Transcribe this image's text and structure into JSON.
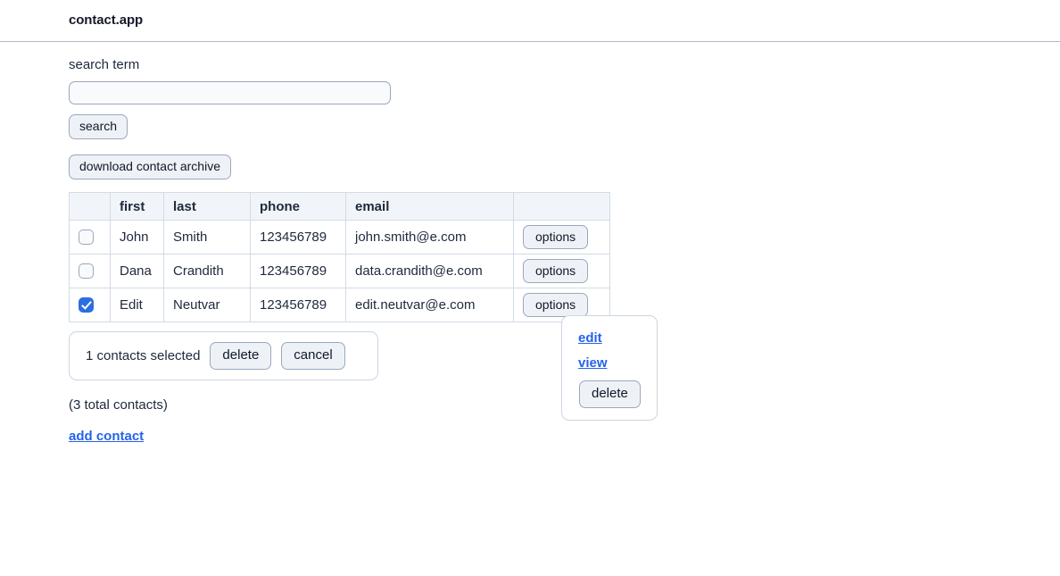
{
  "app": {
    "title": "contact.app"
  },
  "search": {
    "label": "search term",
    "value": "",
    "placeholder": "",
    "button_label": "search"
  },
  "actions": {
    "download_label": "download contact archive"
  },
  "table": {
    "columns": [
      "",
      "first",
      "last",
      "phone",
      "email",
      ""
    ],
    "rows": [
      {
        "selected": false,
        "first": "John",
        "last": "Smith",
        "phone": "123456789",
        "email": "john.smith@e.com",
        "options_label": "options"
      },
      {
        "selected": false,
        "first": "Dana",
        "last": "Crandith",
        "phone": "123456789",
        "email": "data.crandith@e.com",
        "options_label": "options"
      },
      {
        "selected": true,
        "first": "Edit",
        "last": "Neutvar",
        "phone": "123456789",
        "email": "edit.neutvar@e.com",
        "options_label": "options"
      }
    ]
  },
  "selection": {
    "count_text": "1 contacts selected",
    "delete_label": "delete",
    "cancel_label": "cancel"
  },
  "footer": {
    "totals_text": "(3 total contacts)",
    "add_contact_label": "add contact"
  },
  "options_popup": {
    "edit_label": "edit",
    "view_label": "view",
    "delete_label": "delete"
  },
  "colors": {
    "accent": "#2563eb",
    "checkbox_checked": "#2b6ee0",
    "border": "#9aa8bd",
    "table_border": "#d3dbe6",
    "header_bg": "#f1f5f9",
    "button_bg": "#eef2f7",
    "text": "#1e293b"
  }
}
